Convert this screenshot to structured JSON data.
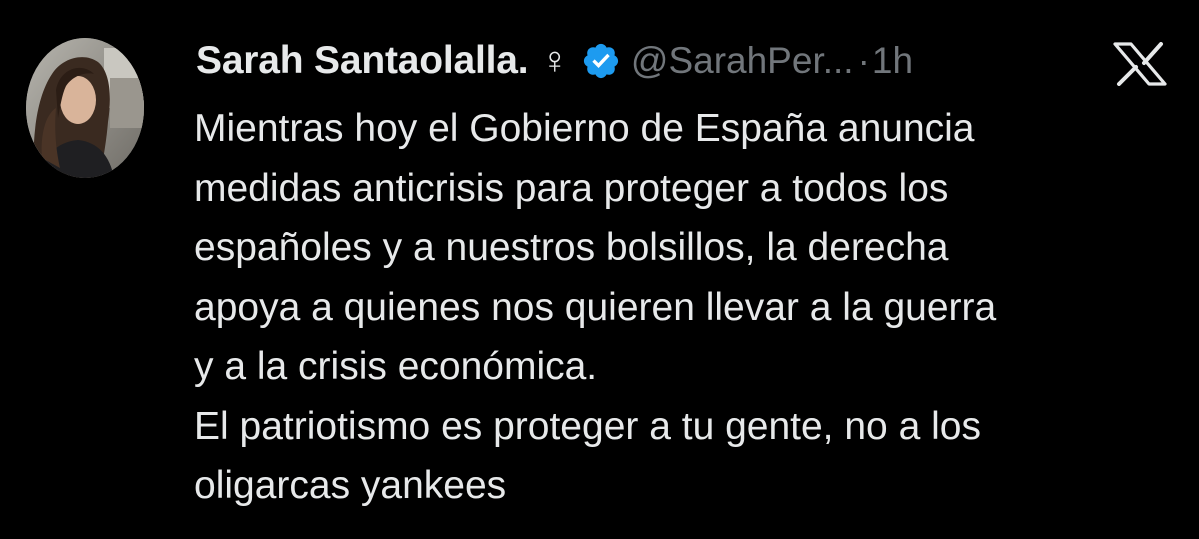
{
  "tweet": {
    "author": {
      "display_name": "Sarah Santaolalla.",
      "gender_symbol": "♀",
      "verified_icon": "verified-badge-icon",
      "handle": "@SarahPer...",
      "avatar": "profile-photo"
    },
    "separator": "·",
    "time": "1h",
    "platform_icon": "x-logo-icon",
    "text_lines": [
      "Mientras hoy el Gobierno de España anuncia",
      "medidas anticrisis para proteger a todos los",
      "españoles y a nuestros bolsillos, la derecha",
      "apoya a quienes nos quieren llevar a la guerra",
      "y a la crisis económica.",
      "El patriotismo es proteger a tu gente, no a los",
      "oligarcas yankees"
    ]
  },
  "colors": {
    "background": "#000000",
    "primary_text": "#e7e9ea",
    "secondary_text": "#71767b",
    "verified_blue": "#1d9bf0"
  }
}
